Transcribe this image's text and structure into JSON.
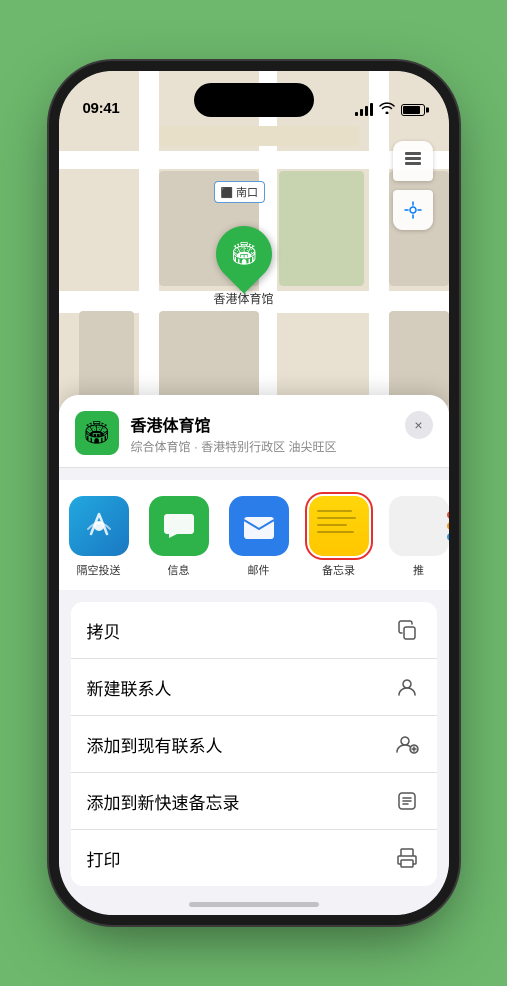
{
  "status": {
    "time": "09:41",
    "direction_icon": "▲"
  },
  "map": {
    "label_text": "南口",
    "pin_label": "香港体育馆",
    "pin_emoji": "🏟"
  },
  "map_buttons": {
    "layers_label": "layers",
    "location_label": "location"
  },
  "venue": {
    "name": "香港体育馆",
    "subtitle": "综合体育馆 · 香港特别行政区 油尖旺区",
    "icon_emoji": "🏟"
  },
  "share_items": [
    {
      "id": "airdrop",
      "label": "隔空投送",
      "type": "airdrop"
    },
    {
      "id": "messages",
      "label": "信息",
      "type": "messages"
    },
    {
      "id": "mail",
      "label": "邮件",
      "type": "mail"
    },
    {
      "id": "notes",
      "label": "备忘录",
      "type": "notes",
      "selected": true
    },
    {
      "id": "more",
      "label": "推",
      "type": "more"
    }
  ],
  "actions": [
    {
      "id": "copy",
      "label": "拷贝",
      "icon": "copy"
    },
    {
      "id": "new-contact",
      "label": "新建联系人",
      "icon": "person"
    },
    {
      "id": "add-existing",
      "label": "添加到现有联系人",
      "icon": "person-add"
    },
    {
      "id": "add-note",
      "label": "添加到新快速备忘录",
      "icon": "note"
    },
    {
      "id": "print",
      "label": "打印",
      "icon": "print"
    }
  ],
  "close_label": "×"
}
